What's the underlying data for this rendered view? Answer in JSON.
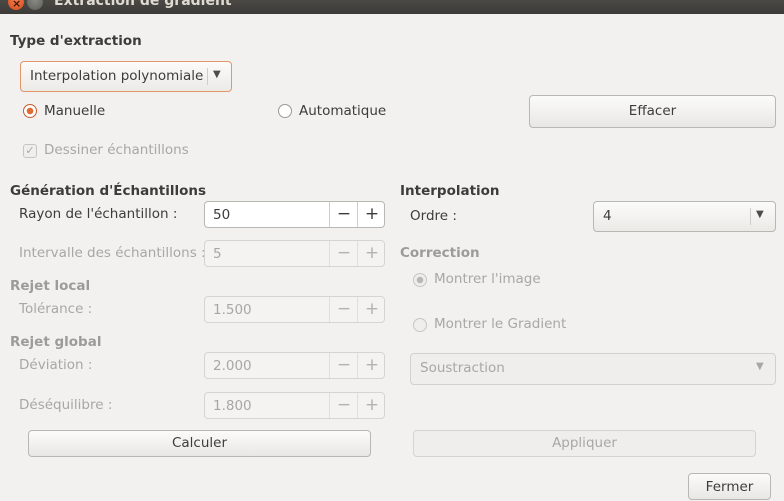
{
  "window": {
    "title": "Extraction de gradient"
  },
  "extraction": {
    "heading": "Type d'extraction",
    "method_selected": "Interpolation polynomiale",
    "mode_manual": "Manuelle",
    "mode_manual_selected": true,
    "mode_auto": "Automatique",
    "clear_button": "Effacer",
    "draw_samples_label": "Dessiner échantillons",
    "draw_samples_checked": true
  },
  "samples": {
    "heading": "Génération d'Échantillons",
    "radius_label": "Rayon de l'échantillon :",
    "radius_value": "50",
    "interval_label": "Intervalle des échantillons :",
    "interval_value": "5"
  },
  "local_reject": {
    "heading": "Rejet local",
    "tolerance_label": "Tolérance :",
    "tolerance_value": "1.500"
  },
  "global_reject": {
    "heading": "Rejet global",
    "deviation_label": "Déviation :",
    "deviation_value": "2.000",
    "imbalance_label": "Déséquilibre :",
    "imbalance_value": "1.800"
  },
  "interpolation": {
    "heading": "Interpolation",
    "order_label": "Ordre :",
    "order_value": "4"
  },
  "correction": {
    "heading": "Correction",
    "show_image": "Montrer l'image",
    "show_gradient": "Montrer le Gradient",
    "operation_selected": "Soustraction"
  },
  "actions": {
    "compute": "Calculer",
    "apply": "Appliquer",
    "close": "Fermer"
  },
  "spin_symbols": {
    "minus": "−",
    "plus": "+"
  },
  "colors": {
    "accent": "#e06a33",
    "window_bg": "#f2f1f0",
    "titlebar": "#3c3b37"
  }
}
